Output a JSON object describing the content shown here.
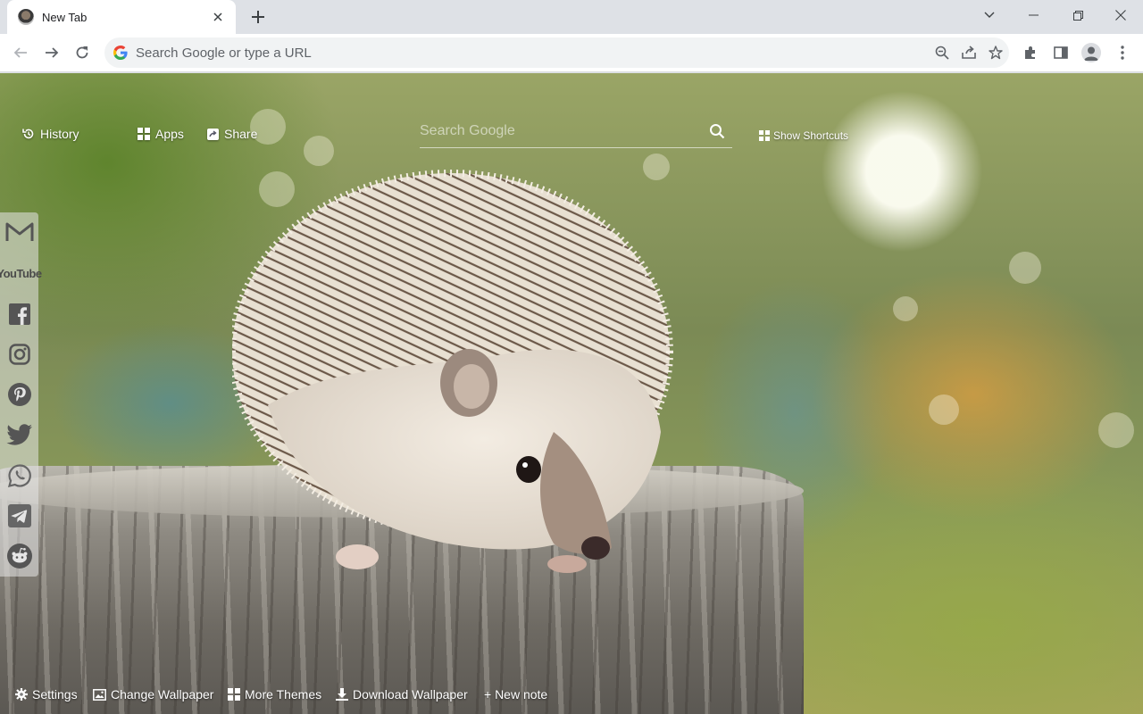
{
  "browser": {
    "tab": {
      "title": "New Tab",
      "close_icon": "close-icon",
      "favicon": "hedgehog-favicon"
    },
    "omnibox": {
      "placeholder": "Search Google or type a URL"
    },
    "icons": [
      "back-icon",
      "forward-icon",
      "reload-icon",
      "zoom-icon",
      "share-icon",
      "star-icon",
      "extensions-icon",
      "side-panel-icon",
      "profile-icon",
      "menu-icon"
    ]
  },
  "newtab": {
    "top": {
      "history_label": "History",
      "apps_label": "Apps",
      "share_label": "Share",
      "search_placeholder": "Search Google",
      "shortcuts_label": "Show Shortcuts"
    },
    "social": [
      "gmail-icon",
      "youtube-icon",
      "facebook-icon",
      "instagram-icon",
      "pinterest-icon",
      "twitter-icon",
      "whatsapp-icon",
      "telegram-icon",
      "reddit-icon"
    ],
    "youtube_text": "YouTube",
    "bottom": {
      "settings_label": "Settings",
      "change_wallpaper_label": "Change Wallpaper",
      "more_themes_label": "More Themes",
      "download_wallpaper_label": "Download Wallpaper",
      "new_note_label": "+ New note"
    }
  },
  "colors": {
    "chrome_frame": "#dee1e6",
    "omnibox_bg": "#f1f3f4",
    "text_light": "#ffffff"
  }
}
